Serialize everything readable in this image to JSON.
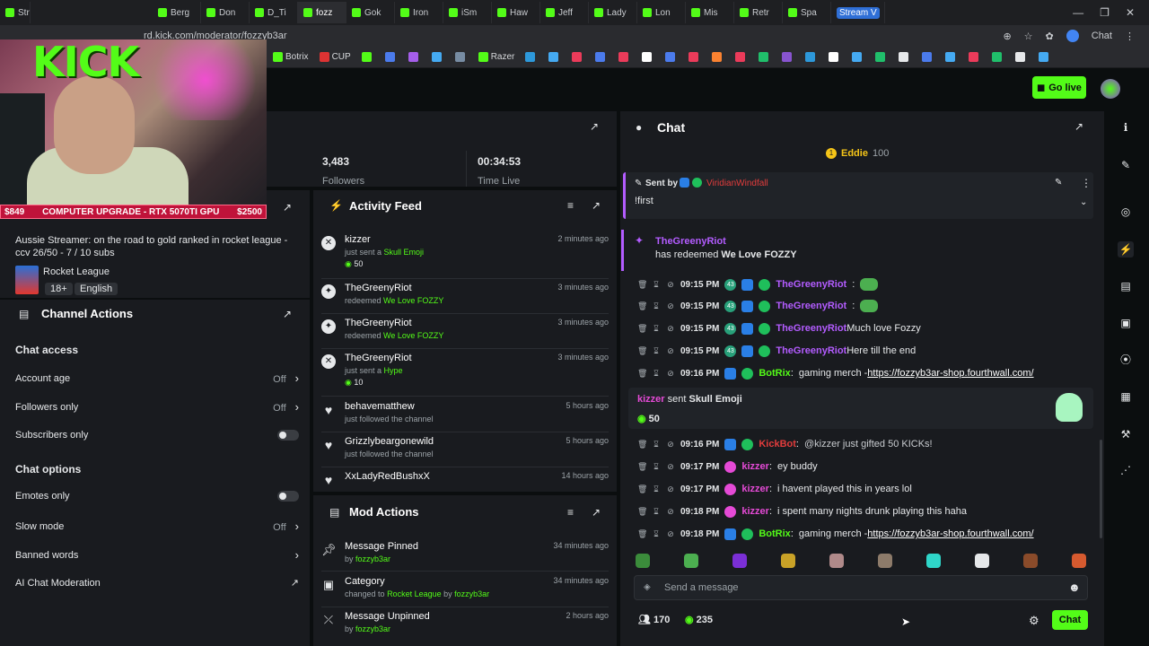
{
  "browser": {
    "tabs": [
      "Str",
      "Berg",
      "Don",
      "D_Ti",
      "fozz",
      "Gok",
      "Iron",
      "iSm",
      "Haw",
      "Jeff",
      "Lady",
      "Lon",
      "Mis",
      "Retr",
      "Spa",
      "Stream V"
    ],
    "address": "rd.kick.com/moderator/fozzyb3ar",
    "chrome_label": "Chat",
    "bookmarks": [
      "Botrix",
      "CUP",
      "Razer"
    ]
  },
  "header": {
    "go_live_label": "Go live"
  },
  "overlay": {
    "logo_text": "KICK",
    "ticker_price": "$849",
    "ticker_text": "COMPUTER UPGRADE - RTX 5070TI GPU",
    "ticker_goal": "$2500"
  },
  "stats": {
    "followers_value": "3,483",
    "followers_label": "Followers",
    "time_value": "00:34:53",
    "time_label": "Time Live"
  },
  "stream_info": {
    "title": "Aussie Streamer: on the road to gold ranked in rocket league - ccv 26/50 - 7 / 10 subs",
    "category": "Rocket League",
    "tags": [
      "18+",
      "English"
    ]
  },
  "channel_actions": {
    "title": "Channel Actions",
    "chat_access_heading": "Chat access",
    "account_age": {
      "label": "Account age",
      "value": "Off"
    },
    "followers_only": {
      "label": "Followers only",
      "value": "Off"
    },
    "subscribers_only": {
      "label": "Subscribers only"
    },
    "chat_options_heading": "Chat options",
    "emotes_only": {
      "label": "Emotes only"
    },
    "slow_mode": {
      "label": "Slow mode",
      "value": "Off"
    },
    "banned_words": {
      "label": "Banned words"
    },
    "ai_moderation": {
      "label": "AI Chat Moderation"
    }
  },
  "activity_feed": {
    "title": "Activity Feed",
    "items": [
      {
        "name": "kizzer",
        "pre": "just sent a",
        "item": "Skull Emoji",
        "amount": "50",
        "time": "2 minutes ago"
      },
      {
        "name": "TheGreenyRiot",
        "pre": "redeemed",
        "item": "We Love FOZZY",
        "time": "3 minutes ago"
      },
      {
        "name": "TheGreenyRiot",
        "pre": "redeemed",
        "item": "We Love FOZZY",
        "time": "3 minutes ago"
      },
      {
        "name": "TheGreenyRiot",
        "pre": "just sent a",
        "item": "Hype",
        "amount": "10",
        "time": "3 minutes ago"
      },
      {
        "name": "behavematthew",
        "pre": "just followed the channel",
        "time": "5 hours ago"
      },
      {
        "name": "Grizzlybeargonewild",
        "pre": "just followed the channel",
        "time": "5 hours ago"
      },
      {
        "name": "XxLadyRedBushxX",
        "pre": "just followed the channel",
        "time": "14 hours ago"
      }
    ]
  },
  "mod_actions": {
    "title": "Mod Actions",
    "items": [
      {
        "name": "Message Pinned",
        "pre": "by",
        "by": "fozzyb3ar",
        "time": "34 minutes ago"
      },
      {
        "name": "Category",
        "pre": "changed to",
        "target": "Rocket League",
        "mid": "by",
        "by": "fozzyb3ar",
        "time": "34 minutes ago"
      },
      {
        "name": "Message Unpinned",
        "pre": "by",
        "by": "fozzyb3ar",
        "time": "2 hours ago"
      }
    ]
  },
  "chat": {
    "title": "Chat",
    "top_gifter": {
      "name": "Eddie",
      "amount": "100"
    },
    "pinned": {
      "label": "Sent by",
      "user": "ViridianWindfall",
      "text": "!first"
    },
    "redeem": {
      "user": "TheGreenyRiot",
      "pre": "has redeemed",
      "reward": "We Love FOZZY"
    },
    "messages": [
      {
        "time": "09:15 PM",
        "user": "TheGreenyRiot",
        "text": "",
        "sub": "43"
      },
      {
        "time": "09:15 PM",
        "user": "TheGreenyRiot",
        "text": "",
        "sub": "43"
      },
      {
        "time": "09:15 PM",
        "user": "TheGreenyRiot",
        "text": "Much love Fozzy",
        "sub": "43"
      },
      {
        "time": "09:15 PM",
        "user": "TheGreenyRiot",
        "text": "Here till the end",
        "sub": "43"
      },
      {
        "time": "09:16 PM",
        "user": "BotRix",
        "text": "gaming merch - ",
        "link": "https://fozzyb3ar-shop.fourthwall.com/"
      }
    ],
    "gift": {
      "user": "kizzer",
      "pre": "sent",
      "item": "Skull Emoji",
      "amount": "50"
    },
    "messages2": [
      {
        "time": "09:16 PM",
        "user": "KickBot",
        "text": "@kizzer just gifted 50 KICKs!"
      },
      {
        "time": "09:17 PM",
        "user": "kizzer",
        "text": "ey buddy"
      },
      {
        "time": "09:17 PM",
        "user": "kizzer",
        "text": "i havent played this in years lol"
      },
      {
        "time": "09:18 PM",
        "user": "kizzer",
        "text": "i spent many nights drunk playing this haha"
      },
      {
        "time": "09:18 PM",
        "user": "BotRix",
        "text": "gaming merch - ",
        "link": "https://fozzyb3ar-shop.fourthwall.com/"
      }
    ],
    "input_placeholder": "Send a message",
    "viewers": "170",
    "kicks": "235",
    "send_label": "Chat"
  }
}
